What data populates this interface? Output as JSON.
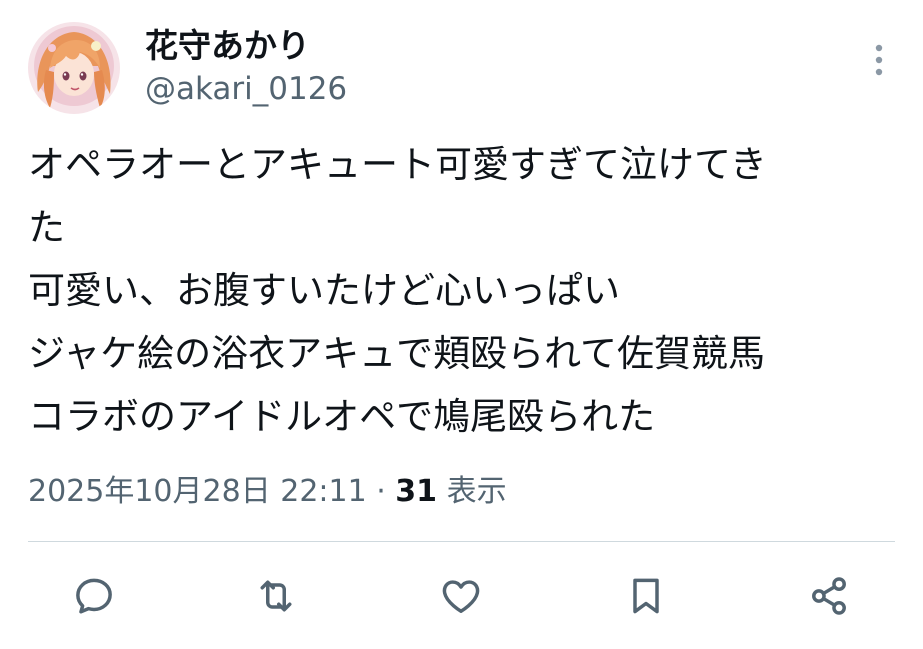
{
  "tweet": {
    "display_name": "花守あかり",
    "handle": "@akari_0126",
    "text_lines": [
      "オペラオーとアキュート可愛すぎて泣けてき",
      "た",
      "可愛い、お腹すいたけど心いっぱい",
      "ジャケ絵の浴衣アキュで頬殴られて佐賀競馬",
      "コラボのアイドルオペで鳩尾殴られた"
    ],
    "timestamp": "2025年10月28日 22:11",
    "separator": " · ",
    "views_count": "31",
    "views_label": " 表示"
  },
  "icons": {
    "more": "more-vertical-icon",
    "reply": "reply-icon",
    "retweet": "retweet-icon",
    "like": "heart-icon",
    "bookmark": "bookmark-icon",
    "share": "share-icon"
  },
  "colors": {
    "text_primary": "#0f1419",
    "text_secondary": "#536471",
    "divider": "#cfd9de",
    "icon": "#536471",
    "more_icon": "#8b98a5"
  }
}
